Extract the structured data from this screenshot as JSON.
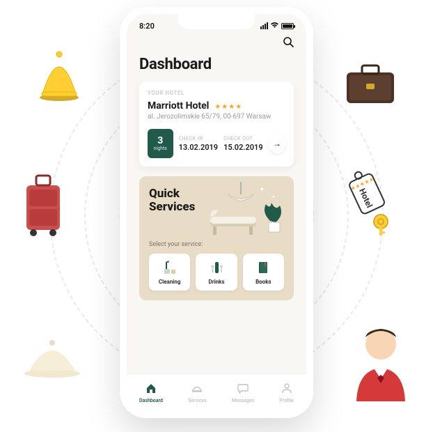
{
  "status": {
    "time": "8:20"
  },
  "page_title": "Dashboard",
  "hotel": {
    "eyebrow": "YOUR HOTEL",
    "name": "Marriott Hotel",
    "stars": "★★★★",
    "address": "al. Jerozolimskie 65/79, 00-697 Warsaw",
    "nights_value": "3",
    "nights_label": "nights",
    "check_in_label": "CHECK IN",
    "check_in_value": "13.02.2019",
    "check_out_label": "CHECK OUT",
    "check_out_value": "15.02.2019"
  },
  "quick": {
    "title_line1": "Quick",
    "title_line2": "Services",
    "select_label": "Select your service:",
    "services": [
      {
        "label": "Cleaning"
      },
      {
        "label": "Drinks"
      },
      {
        "label": "Books"
      }
    ]
  },
  "tabs": [
    {
      "label": "Dashboard"
    },
    {
      "label": "Services"
    },
    {
      "label": "Messages"
    },
    {
      "label": "Profile"
    }
  ]
}
